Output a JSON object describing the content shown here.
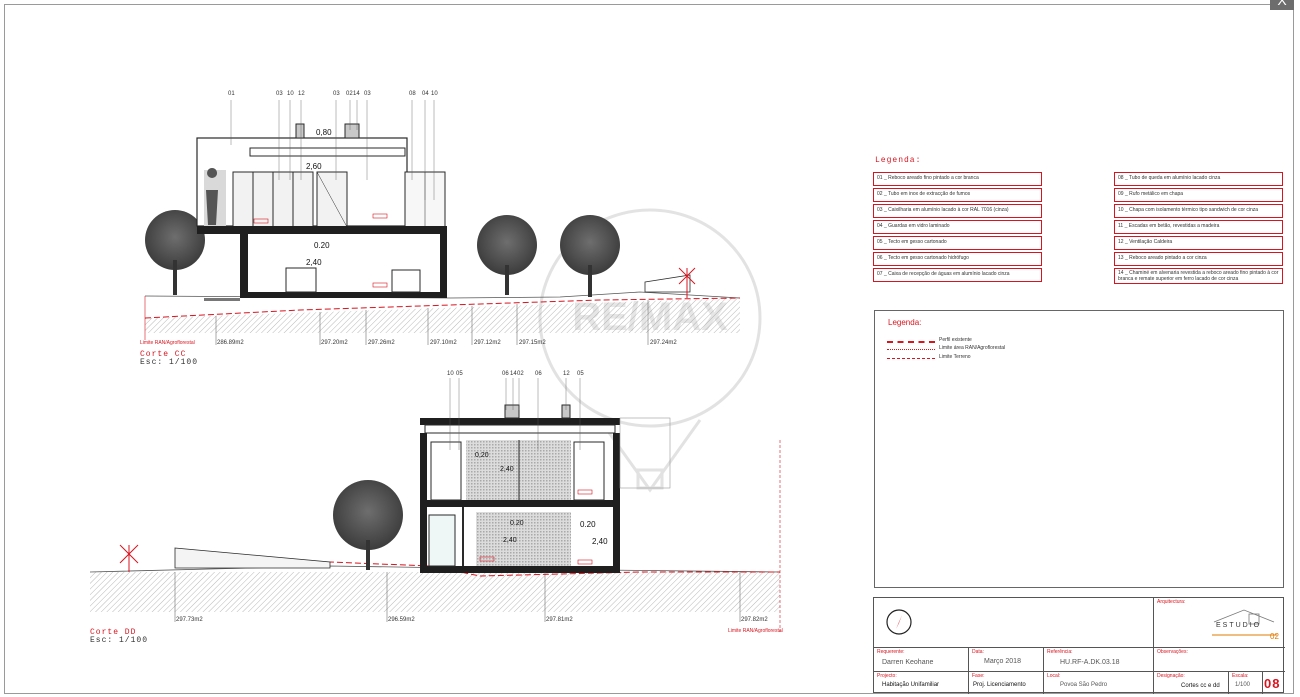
{
  "window": {
    "close_label": "X"
  },
  "colors": {
    "accent": "#d8151f",
    "line": "#2a2a2a",
    "hatch": "#8a8a8a"
  },
  "section_cc": {
    "title": "Corte CC",
    "scale": "Esc: 1/100",
    "limit_label": "Limite RAN/Agroflorestal",
    "callouts": [
      "01",
      "03",
      "10",
      "12",
      "03",
      "02",
      "14",
      "03",
      "08",
      "04",
      "10"
    ],
    "dims": [
      "0,80",
      "2,60",
      "0.20",
      "2,40"
    ],
    "levels": [
      "286.89m2",
      "297.20m2",
      "297.26m2",
      "297.10m2",
      "297.12m2",
      "297.15m2",
      "297.24m2"
    ]
  },
  "section_dd": {
    "title": "Corte DD",
    "scale": "Esc: 1/100",
    "limit_label": "Limite RAN/Agroflorestal",
    "callouts": [
      "10",
      "05",
      "06",
      "14",
      "02",
      "06",
      "12",
      "05"
    ],
    "dims": [
      "0,20",
      "2,40",
      "0.20",
      "2,40",
      "0.20",
      "2,40"
    ],
    "levels": [
      "297.73m2",
      "296.59m2",
      "297.81m2",
      "297.82m2"
    ]
  },
  "legend": {
    "title": "Legenda:",
    "left": [
      "01 _ Reboco areado fino pintado a cor branca",
      "02 _ Tubo em inox de extracção de fumos",
      "03 _ Caixilharia em alumínio lacado à cor RAL 7016 (cinza)",
      "04 _ Guardas em vidro laminado",
      "05 _ Tecto em gesso cartonado",
      "06 _ Tecto em gesso cartonado hidrófugo",
      "07 _ Caixa de recepção de águas em alumínio lacado cinza"
    ],
    "right": [
      "08 _ Tubo de queda em alumínio lacado cinza",
      "09 _ Rufo metálico em chapa",
      "10 _ Chapa com isolamento térmico tipo sandwich de cor cinza",
      "11 _ Escadas em betão, revestidas a madeira",
      "12 _ Ventilação Caldeira",
      "13 _ Reboco areado pintado a cor cinza",
      "14 _ Chaminé em alvenaria revestida a reboco areado fino pintado à cor branca e remate superior em ferro lacado de cor cinza"
    ]
  },
  "line_legend": {
    "title": "Legenda:",
    "items": [
      "Perfil existente",
      "Limite área RAN/Agroflorestal",
      "Limite Terreno"
    ]
  },
  "title_block": {
    "arquitectura_label": "Arquitectura:",
    "studio_name": "ESTUDIO",
    "studio_number": "02",
    "requerente_label": "Requerente:",
    "requerente": "Darren Keohane",
    "data_label": "Data:",
    "data": "Março 2018",
    "referencia_label": "Referência:",
    "referencia": "HU.RF-A.DK.03.18",
    "observacoes_label": "Observações:",
    "projecto_label": "Projecto:",
    "projecto": "Habitação Unifamiliar",
    "fase_label": "Fase:",
    "fase": "Proj. Licenciamento",
    "local_label": "Local:",
    "local": "Povoa São Pedro",
    "designacao_label": "Designação:",
    "designacao": "Cortes cc e dd",
    "escala_label": "Escala:",
    "escala": "1/100",
    "sheet_number": "08"
  },
  "watermark": {
    "brand": "RE/MAX"
  }
}
